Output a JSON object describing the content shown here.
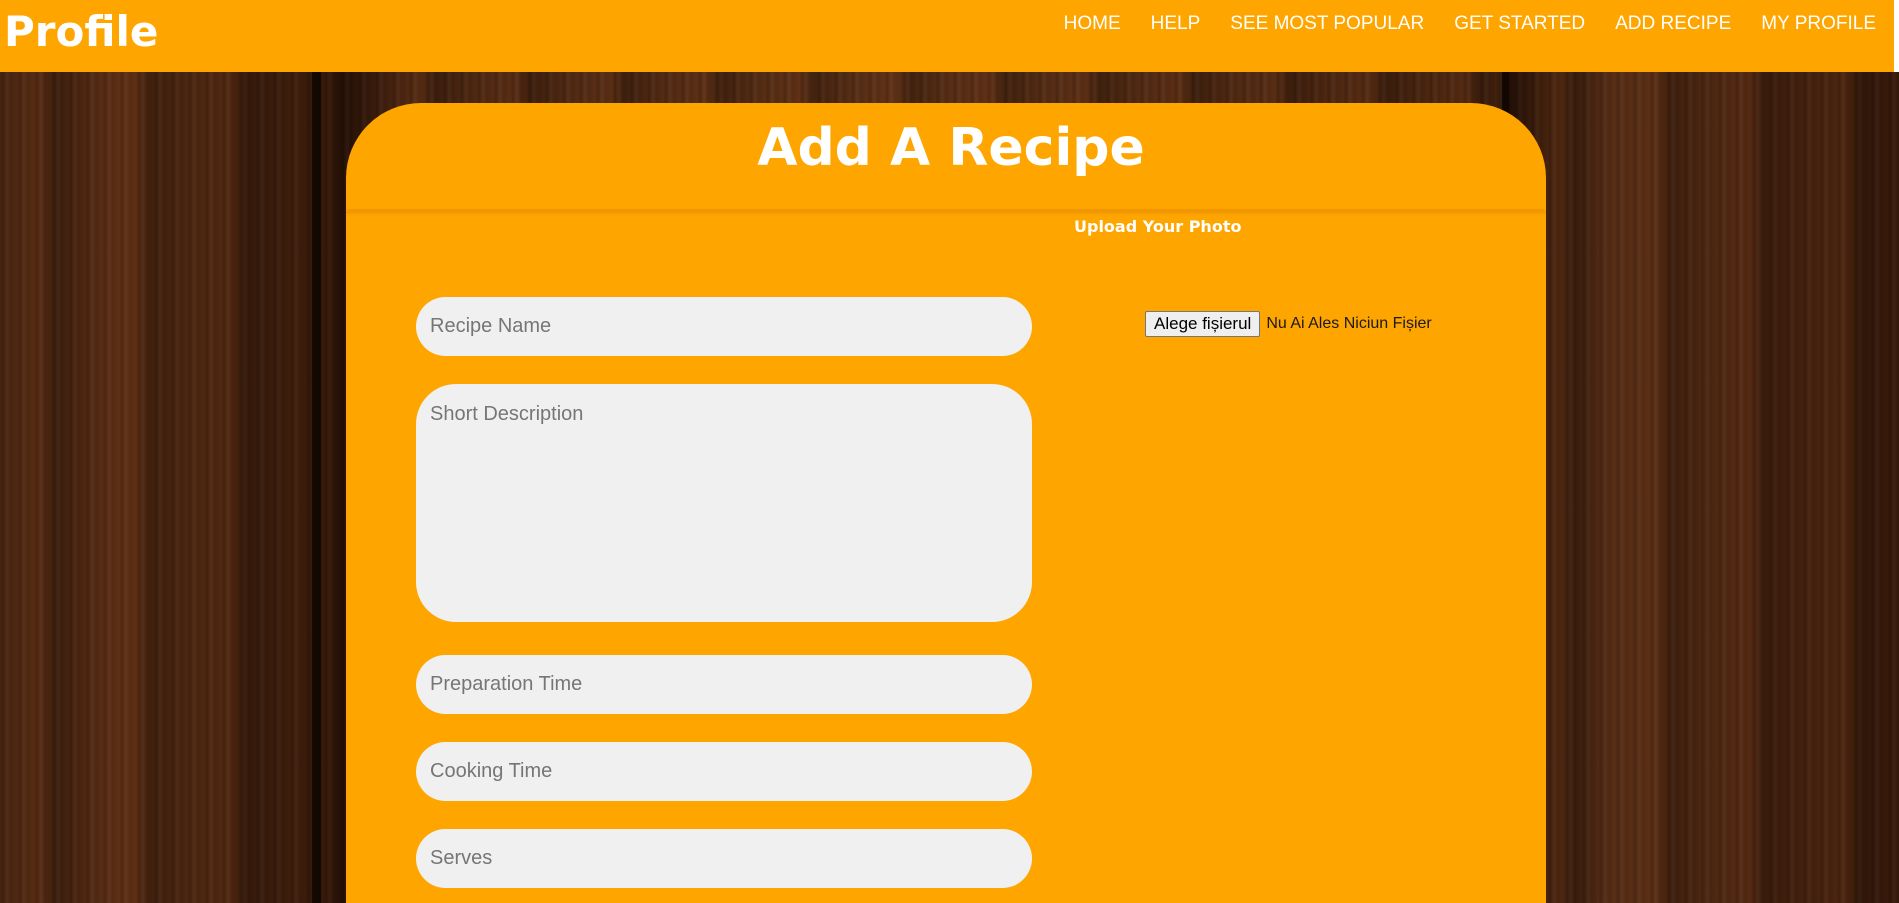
{
  "navbar": {
    "brand": "Profile",
    "links": [
      {
        "label": "HOME"
      },
      {
        "label": "HELP"
      },
      {
        "label": "SEE MOST POPULAR"
      },
      {
        "label": "GET STARTED"
      },
      {
        "label": "ADD RECIPE"
      },
      {
        "label": "MY PROFILE"
      }
    ]
  },
  "form": {
    "title": "Add A Recipe",
    "upload_label": "Upload Your Photo",
    "file_button_label": "Alege fișierul",
    "file_status": "Nu Ai Ales Niciun Fișier",
    "fields": {
      "recipe_name": {
        "placeholder": "Recipe Name",
        "value": ""
      },
      "short_description": {
        "placeholder": "Short Description",
        "value": ""
      },
      "preparation_time": {
        "placeholder": "Preparation Time",
        "value": ""
      },
      "cooking_time": {
        "placeholder": "Cooking Time",
        "value": ""
      },
      "serves": {
        "placeholder": "Serves",
        "value": ""
      }
    }
  },
  "colors": {
    "accent": "#ffa500",
    "text_on_accent": "#ffffff",
    "field_background": "#f0f0f0"
  }
}
